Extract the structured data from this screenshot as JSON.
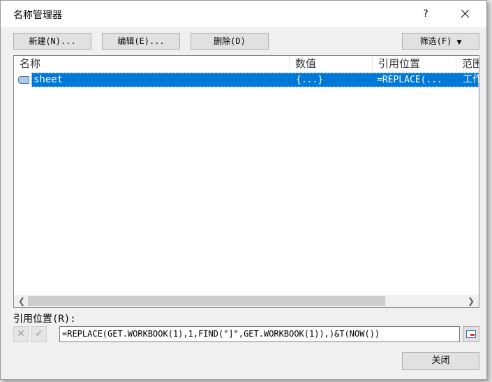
{
  "window": {
    "title": "名称管理器",
    "help": "?"
  },
  "toolbar": {
    "new_label": "新建(N)...",
    "edit_label": "编辑(E)...",
    "delete_label": "删除(D)",
    "filter_label": "筛选(F)"
  },
  "list": {
    "columns": [
      "名称",
      "数值",
      "引用位置",
      "范围"
    ],
    "rows": [
      {
        "name": "sheet",
        "value": "{...}",
        "refers_to": "=REPLACE(...",
        "scope": "工作"
      }
    ]
  },
  "reference": {
    "label": "引用位置(R):",
    "value": "=REPLACE(GET.WORKBOOK(1),1,FIND(\"]\",GET.WORKBOOK(1)),)&T(NOW())"
  },
  "footer": {
    "close_label": "关闭"
  },
  "colors": {
    "selection": "#0078d7",
    "button": "#e1e1e1"
  }
}
